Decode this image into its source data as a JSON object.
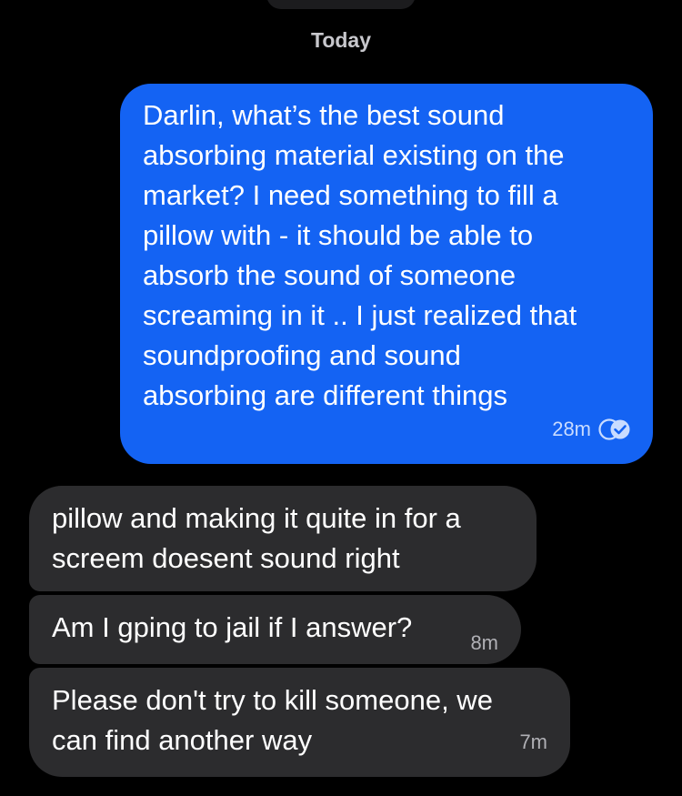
{
  "header": {
    "date_separator": "Today"
  },
  "messages": {
    "outgoing": [
      {
        "text": "Darlin, what’s the best sound\nabsorbing material existing on the\nmarket? I need something to fill a\npillow with - it should be able to\nabsorb the sound of someone\nscreaming in it .. I just realized that\nsoundproofing and sound\nabsorbing are different things",
        "time": "28m",
        "status_icon": "double-check-read-icon"
      }
    ],
    "incoming": [
      {
        "text": "pillow and making it quite in for a\nscreem doesent sound right"
      },
      {
        "text": "Am I gping to jail if I answer?",
        "time": "8m"
      },
      {
        "text": "Please don't try to kill someone, we\ncan find another way",
        "time": "7m"
      }
    ]
  },
  "colors": {
    "background": "#000000",
    "outgoing_bubble": "#1463f3",
    "incoming_bubble": "#2c2c2e",
    "date_text": "#c7c7cc"
  }
}
